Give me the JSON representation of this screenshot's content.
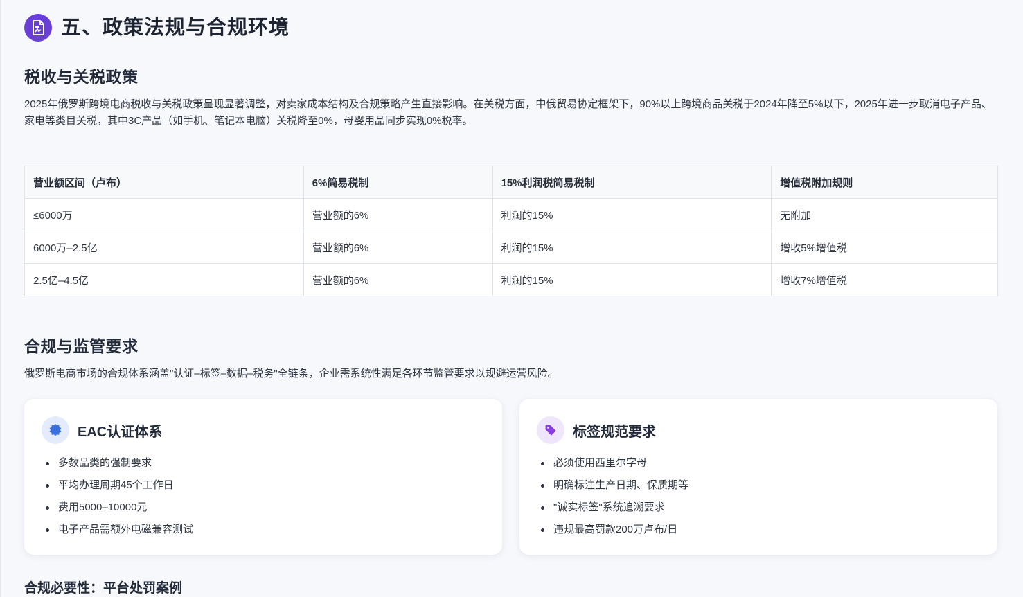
{
  "header": {
    "icon": "document-chart-icon",
    "title": "五、政策法规与合规环境"
  },
  "tax_section": {
    "title": "税收与关税政策",
    "paragraph": "2025年俄罗斯跨境电商税收与关税政策呈现显著调整，对卖家成本结构及合规策略产生直接影响。在关税方面，中俄贸易协定框架下，90%以上跨境商品关税于2024年降至5%以下，2025年进一步取消电子产品、家电等类目关税，其中3C产品（如手机、笔记本电脑）关税降至0%，母婴用品同步实现0%税率。",
    "table": {
      "headers": [
        "营业额区间（卢布）",
        "6%简易税制",
        "15%利润税简易税制",
        "增值税附加规则"
      ],
      "rows": [
        [
          "≤6000万",
          "营业额的6%",
          "利润的15%",
          "无附加"
        ],
        [
          "6000万–2.5亿",
          "营业额的6%",
          "利润的15%",
          "增收5%增值税"
        ],
        [
          "2.5亿–4.5亿",
          "营业额的6%",
          "利润的15%",
          "增收7%增值税"
        ]
      ]
    }
  },
  "compliance_section": {
    "title": "合规与监管要求",
    "paragraph": "俄罗斯电商市场的合规体系涵盖\"认证–标签–数据–税务\"全链条，企业需系统性满足各环节监管要求以规避运营风险。",
    "cards": [
      {
        "icon": "certificate-badge-icon",
        "icon_color": "#3b6fe0",
        "title": "EAC认证体系",
        "items": [
          "多数品类的强制要求",
          "平均办理周期45个工作日",
          "费用5000–10000元",
          "电子产品需额外电磁兼容测试"
        ]
      },
      {
        "icon": "tag-icon",
        "icon_color": "#8b3fe0",
        "title": "标签规范要求",
        "items": [
          "必须使用西里尔字母",
          "明确标注生产日期、保质期等",
          "\"诚实标签\"系统追溯要求",
          "违规最高罚款200万卢布/日"
        ]
      }
    ],
    "subheading": "合规必要性：平台处罚案例"
  },
  "colors": {
    "accent": "#6a3fd6",
    "background": "#f6f8fc",
    "table_border": "#dfe3ea"
  }
}
